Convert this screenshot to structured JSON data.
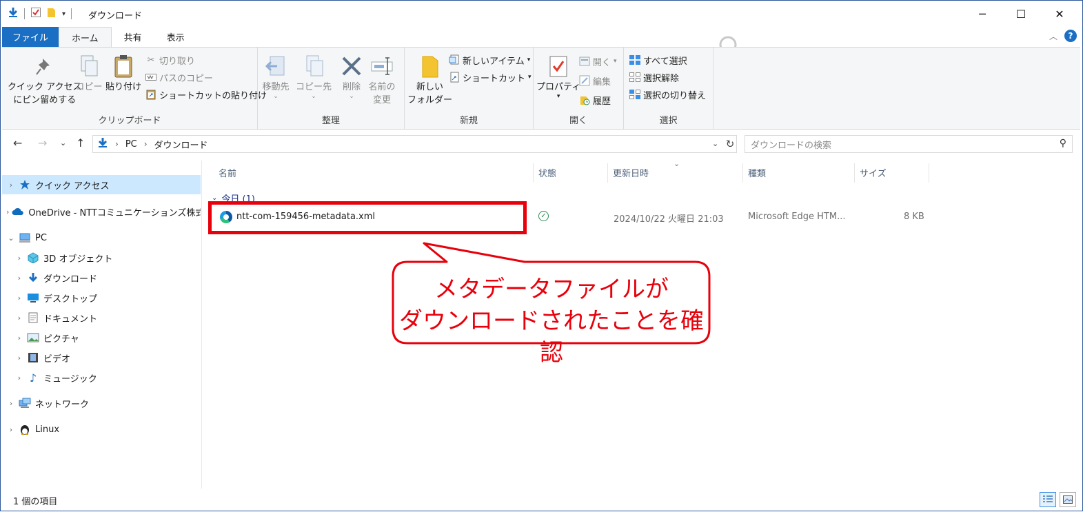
{
  "window": {
    "title": "ダウンロード",
    "controls": {
      "minimize": "─",
      "maximize": "☐",
      "close": "✕"
    }
  },
  "ribbon_tabs": [
    "ファイル",
    "ホーム",
    "共有",
    "表示"
  ],
  "ribbon": {
    "clipboard": {
      "label": "クリップボード",
      "pin_line1": "クイック アクセス",
      "pin_line2": "にピン留めする",
      "copy": "コピー",
      "paste": "貼り付け",
      "cut": "切り取り",
      "copy_path": "パスのコピー",
      "paste_shortcut": "ショートカットの貼り付け"
    },
    "organize": {
      "label": "整理",
      "move_to": "移動先",
      "copy_to": "コピー先",
      "delete": "削除",
      "rename_line1": "名前の",
      "rename_line2": "変更"
    },
    "new": {
      "label": "新規",
      "folder_line1": "新しい",
      "folder_line2": "フォルダー",
      "new_item": "新しいアイテム",
      "shortcut": "ショートカット"
    },
    "open": {
      "label": "開く",
      "properties": "プロパティ",
      "open": "開く",
      "edit": "編集",
      "history": "履歴"
    },
    "select": {
      "label": "選択",
      "select_all": "すべて選択",
      "select_none": "選択解除",
      "invert": "選択の切り替え"
    }
  },
  "address": {
    "crumbs": [
      "PC",
      "ダウンロード"
    ],
    "search_placeholder": "ダウンロードの検索"
  },
  "nav": [
    {
      "label": "クイック アクセス",
      "icon": "star-icon",
      "expanded": false,
      "selected": true
    },
    {
      "label": "OneDrive - NTTコミュニケーションズ株式会社",
      "icon": "onedrive-icon",
      "expanded": false
    },
    {
      "label": "PC",
      "icon": "pc-icon",
      "expanded": true
    },
    {
      "label": "3D オブジェクト",
      "icon": "3d-objects-icon"
    },
    {
      "label": "ダウンロード",
      "icon": "download-icon"
    },
    {
      "label": "デスクトップ",
      "icon": "desktop-icon"
    },
    {
      "label": "ドキュメント",
      "icon": "documents-icon"
    },
    {
      "label": "ピクチャ",
      "icon": "pictures-icon"
    },
    {
      "label": "ビデオ",
      "icon": "video-icon"
    },
    {
      "label": "ミュージック",
      "icon": "music-icon"
    },
    {
      "label": "ネットワーク",
      "icon": "network-icon"
    },
    {
      "label": "Linux",
      "icon": "linux-icon"
    }
  ],
  "columns": [
    "名前",
    "状態",
    "更新日時",
    "種類",
    "サイズ"
  ],
  "group_header": "今日 (1)",
  "files": [
    {
      "name": "ntt-com-159456-metadata.xml",
      "modified": "2024/10/22 火曜日 21:03",
      "type": "Microsoft Edge HTM...",
      "size": "8 KB"
    }
  ],
  "callout": {
    "line1": "メタデータファイルが",
    "line2": "ダウンロードされたことを確認",
    "color": "#e8000b"
  },
  "status": {
    "count": "1 個の項目"
  }
}
